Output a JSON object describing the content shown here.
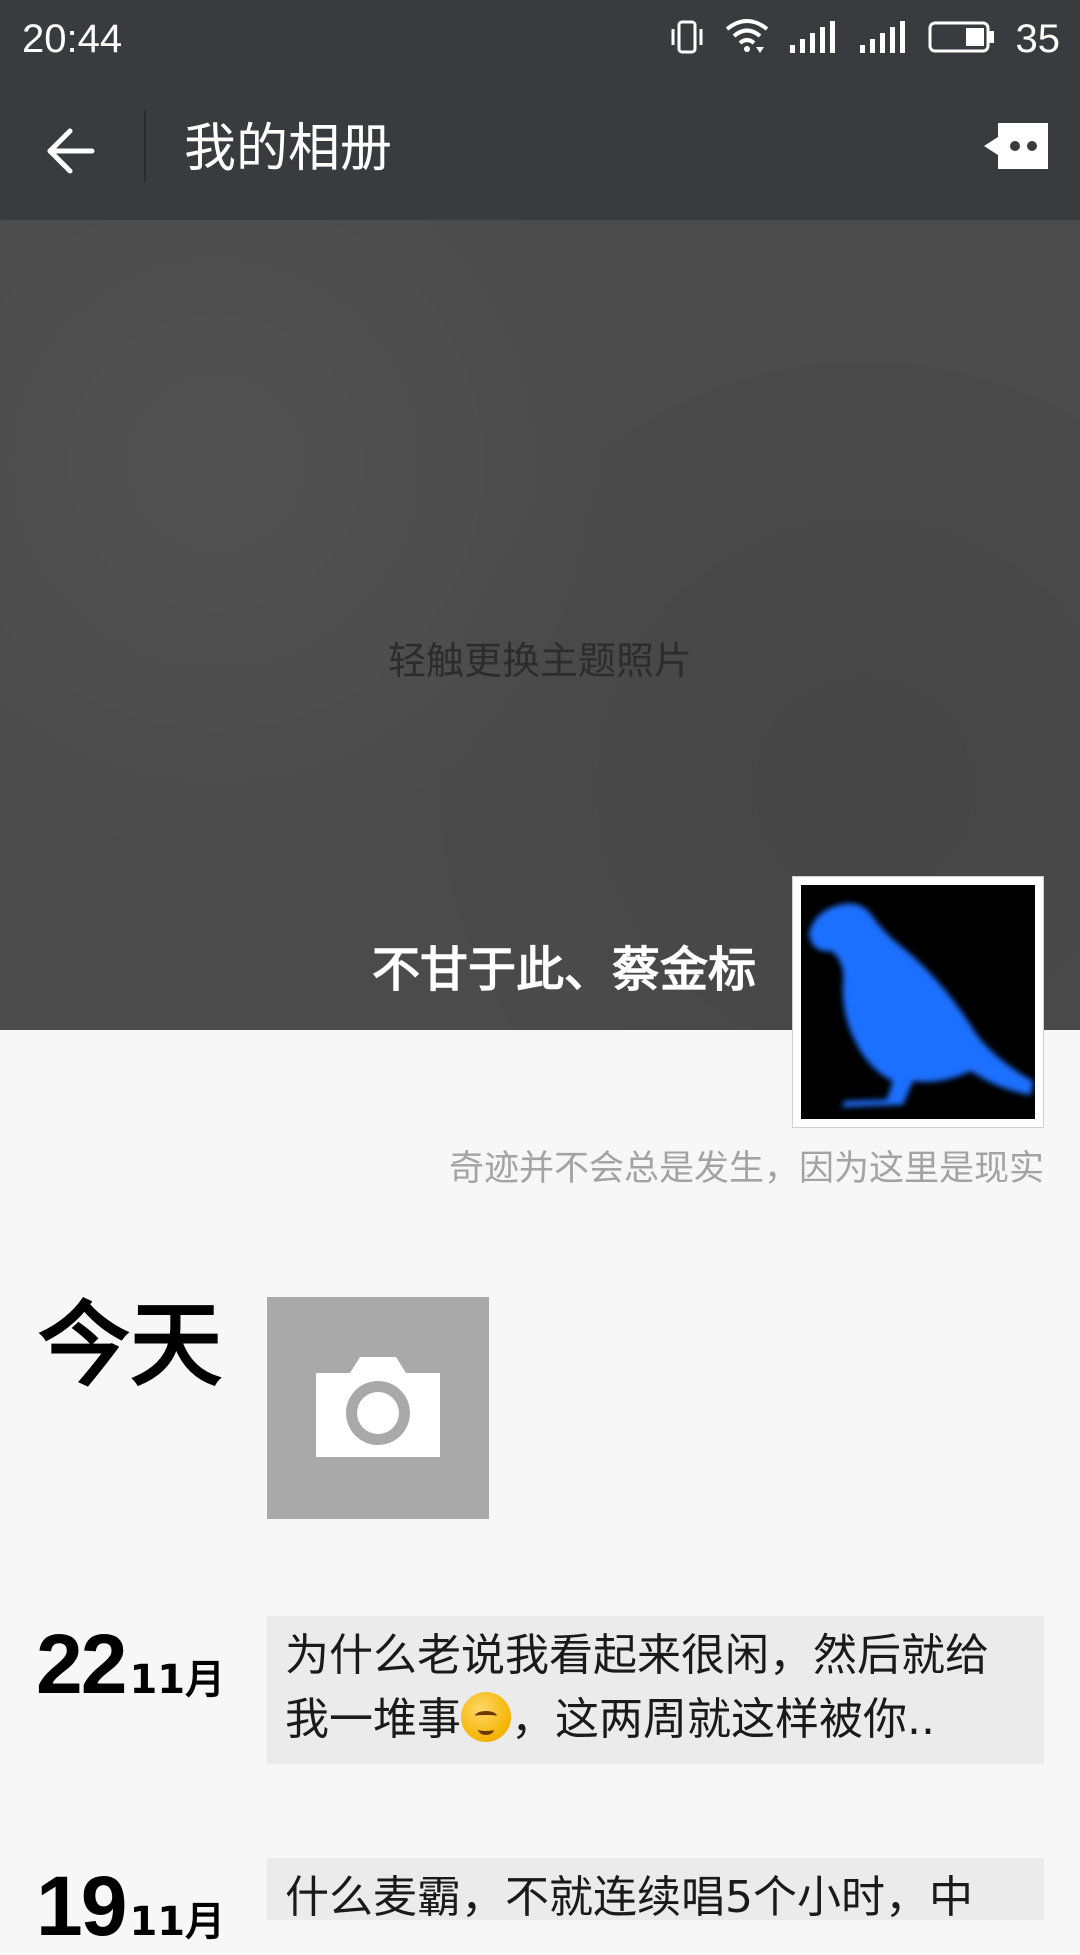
{
  "status_bar": {
    "time": "20:44",
    "battery_level": "35",
    "icons": [
      "vibrate-icon",
      "wifi-icon",
      "signal-icon",
      "signal-icon",
      "battery-icon"
    ]
  },
  "header": {
    "title": "我的相册",
    "back_icon": "arrow-left-icon",
    "action_icon": "message-icon"
  },
  "cover": {
    "hint": "轻触更换主题照片",
    "profile_name": "不甘于此、蔡金标",
    "signature": "奇迹并不会总是发生，因为这里是现实"
  },
  "feed": {
    "today_label": "今天",
    "camera_icon": "camera-icon",
    "posts": [
      {
        "day": "22",
        "month": "11月",
        "text_line1": "为什么老说我看起来很闲，然后就给",
        "text_line2_before": "我一堆事",
        "emoji": "blushing-face-emoji",
        "text_line2_after": "，这两周就这样被你.."
      },
      {
        "day": "19",
        "month": "11月",
        "text_line1": "什么麦霸，不就连续唱5个小时，中"
      }
    ]
  },
  "colors": {
    "top_bar": "#3a3b3f",
    "cover_bg": "#4b4b4b",
    "page_bg": "#f7f7f7",
    "post_card": "#ebebeb",
    "camera_tile": "#a9a9a9",
    "avatar_bird": "#1f6fff"
  }
}
